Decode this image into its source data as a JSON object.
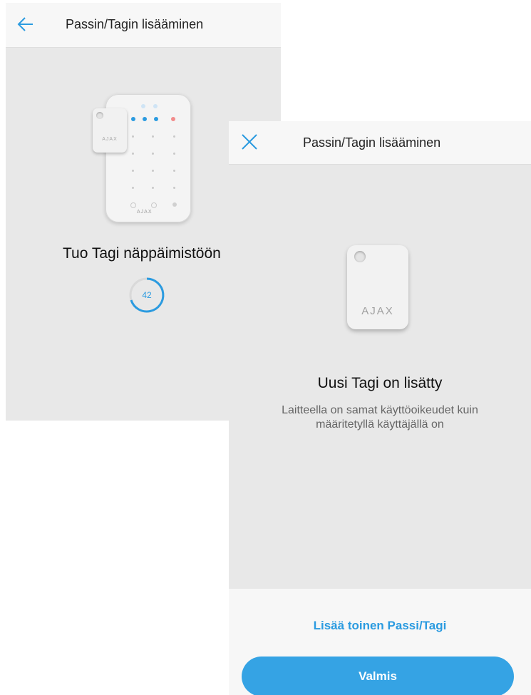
{
  "back_screen": {
    "title": "Passin/Tagin lisääminen",
    "keypad_brand": "AJAX",
    "tag_brand": "AJAX",
    "instruction": "Tuo Tagi näppäimistöön",
    "timer_value": "42",
    "icons": {
      "back": "arrow-left-icon"
    }
  },
  "front_screen": {
    "title": "Passin/Tagin lisääminen",
    "tag_brand": "AJAX",
    "success_title": "Uusi Tagi on lisätty",
    "success_description": "Laitteella on samat käyttöoikeudet kuin määritetyllä käyttäjällä on",
    "add_another_label": "Lisää toinen Passi/Tagi",
    "done_label": "Valmis",
    "icons": {
      "close": "close-icon"
    }
  },
  "colors": {
    "accent": "#2b9be0",
    "button": "#35a3e4",
    "background": "#e8e8e8",
    "appbar": "#f7f7f7"
  }
}
